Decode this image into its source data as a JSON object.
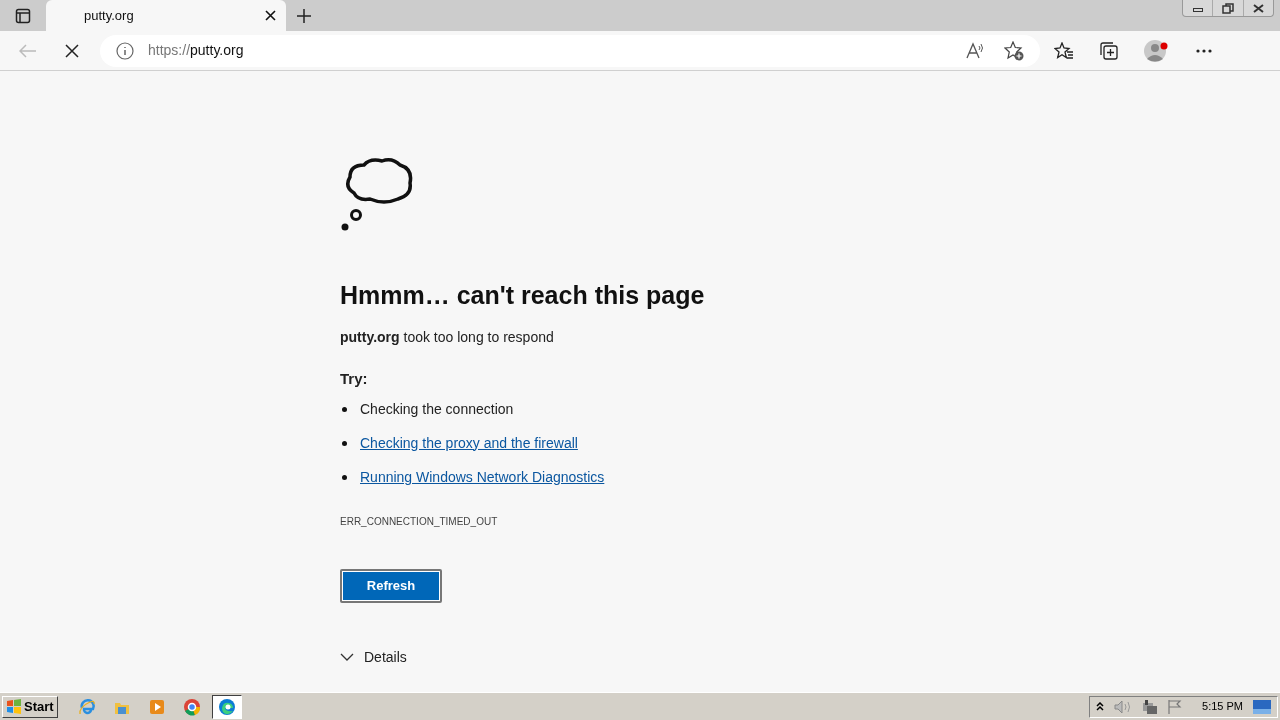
{
  "tabs": [
    {
      "title": "putty.org",
      "selected": true
    }
  ],
  "address": {
    "scheme": "https://",
    "host": "putty.org"
  },
  "page": {
    "heading": "Hmmm… can't reach this page",
    "message": "**putty.org** took too long to respond",
    "try_label": "Try:",
    "suggestions": [
      {
        "text": "Checking the connection",
        "kind": "text"
      },
      {
        "text": "Checking the proxy and the firewall",
        "kind": "link"
      },
      {
        "text": "Running Windows Network Diagnostics",
        "kind": "link"
      }
    ],
    "error_code": "ERR_CONNECTION_TIMED_OUT",
    "refresh_button": "Refresh",
    "details": {
      "label": "Details",
      "expanded": false
    }
  },
  "taskbar": {
    "start": "Start",
    "apps": [
      {
        "kind": "ie",
        "selected": false
      },
      {
        "kind": "folder",
        "selected": false
      },
      {
        "kind": "media",
        "selected": false
      },
      {
        "kind": "chrome",
        "selected": false
      },
      {
        "kind": "edge",
        "selected": true
      }
    ],
    "clock": "5:15 PM"
  }
}
